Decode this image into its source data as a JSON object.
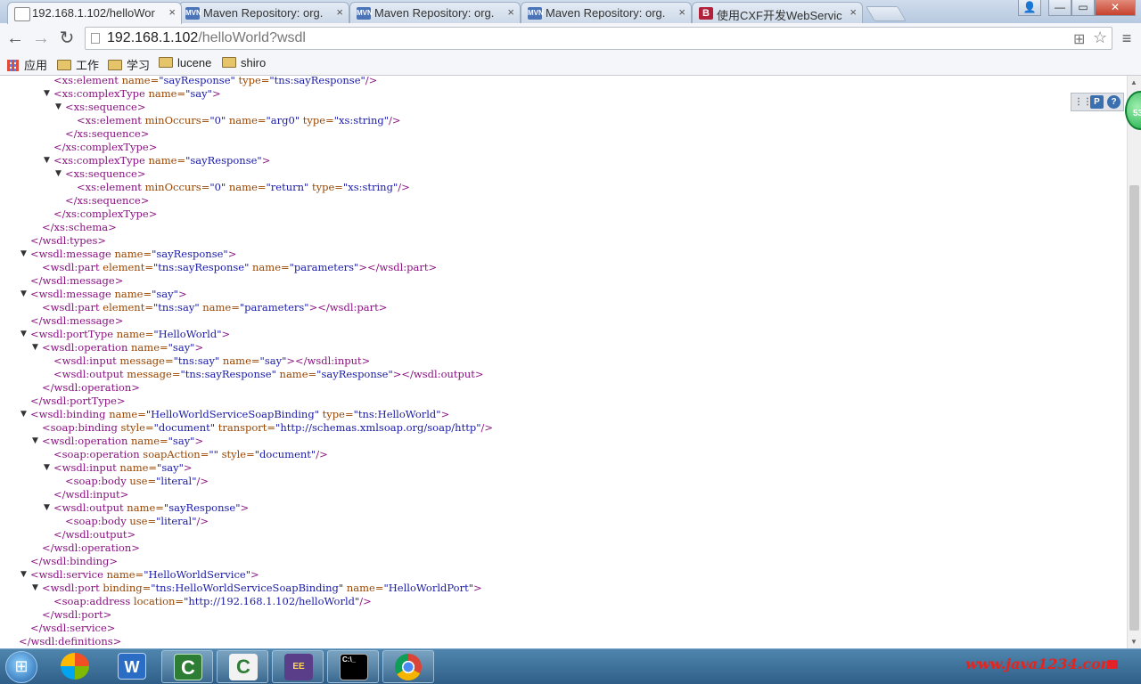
{
  "tabs": [
    {
      "title": "192.168.1.102/helloWor",
      "active": true,
      "favicon": "page-icon"
    },
    {
      "title": "Maven Repository: org.",
      "favicon": "maven-icon"
    },
    {
      "title": "Maven Repository: org.",
      "favicon": "maven-icon"
    },
    {
      "title": "Maven Repository: org.",
      "favicon": "maven-icon"
    },
    {
      "title": "使用CXF开发WebService",
      "favicon": "baidu-icon"
    }
  ],
  "favicon_maven_text": "MVN",
  "favicon_baidu_text": "B",
  "tab_close": "×",
  "window_buttons": {
    "minimize": "—",
    "maximize": "▭",
    "close": "✕"
  },
  "nav": {
    "back": "←",
    "forward": "→",
    "reload": "↻",
    "menu": "≡"
  },
  "omnibox": {
    "host": "192.168.1.102",
    "path": "/helloWorld?wsdl",
    "translate_icon": "⊞",
    "star_icon": "☆"
  },
  "bookmarks": [
    {
      "label": "应用",
      "kind": "apps"
    },
    {
      "label": "工作",
      "kind": "folder"
    },
    {
      "label": "学习",
      "kind": "folder"
    },
    {
      "label": "lucene",
      "kind": "folder"
    },
    {
      "label": "shiro",
      "kind": "folder"
    }
  ],
  "xml_lines": [
    {
      "indent": 3,
      "collapsible": false,
      "parts": [
        [
          "tg",
          "<xs:element"
        ],
        [
          "an",
          " name="
        ],
        [
          "av",
          "\"sayResponse\""
        ],
        [
          "an",
          " type="
        ],
        [
          "av",
          "\"tns:sayResponse\""
        ],
        [
          "tg",
          "/>"
        ]
      ]
    },
    {
      "indent": 3,
      "collapsible": true,
      "parts": [
        [
          "tg",
          "<xs:complexType"
        ],
        [
          "an",
          " name="
        ],
        [
          "av",
          "\"say\""
        ],
        [
          "tg",
          ">"
        ]
      ]
    },
    {
      "indent": 4,
      "collapsible": true,
      "parts": [
        [
          "tg",
          "<xs:sequence>"
        ]
      ]
    },
    {
      "indent": 5,
      "collapsible": false,
      "parts": [
        [
          "tg",
          "<xs:element"
        ],
        [
          "an",
          " minOccurs="
        ],
        [
          "av",
          "\"0\""
        ],
        [
          "an",
          " name="
        ],
        [
          "av",
          "\"arg0\""
        ],
        [
          "an",
          " type="
        ],
        [
          "av",
          "\"xs:string\""
        ],
        [
          "tg",
          "/>"
        ]
      ]
    },
    {
      "indent": 4,
      "collapsible": false,
      "parts": [
        [
          "tg",
          "</xs:sequence>"
        ]
      ]
    },
    {
      "indent": 3,
      "collapsible": false,
      "parts": [
        [
          "tg",
          "</xs:complexType>"
        ]
      ]
    },
    {
      "indent": 3,
      "collapsible": true,
      "parts": [
        [
          "tg",
          "<xs:complexType"
        ],
        [
          "an",
          " name="
        ],
        [
          "av",
          "\"sayResponse\""
        ],
        [
          "tg",
          ">"
        ]
      ]
    },
    {
      "indent": 4,
      "collapsible": true,
      "parts": [
        [
          "tg",
          "<xs:sequence>"
        ]
      ]
    },
    {
      "indent": 5,
      "collapsible": false,
      "parts": [
        [
          "tg",
          "<xs:element"
        ],
        [
          "an",
          " minOccurs="
        ],
        [
          "av",
          "\"0\""
        ],
        [
          "an",
          " name="
        ],
        [
          "av",
          "\"return\""
        ],
        [
          "an",
          " type="
        ],
        [
          "av",
          "\"xs:string\""
        ],
        [
          "tg",
          "/>"
        ]
      ]
    },
    {
      "indent": 4,
      "collapsible": false,
      "parts": [
        [
          "tg",
          "</xs:sequence>"
        ]
      ]
    },
    {
      "indent": 3,
      "collapsible": false,
      "parts": [
        [
          "tg",
          "</xs:complexType>"
        ]
      ]
    },
    {
      "indent": 2,
      "collapsible": false,
      "parts": [
        [
          "tg",
          "</xs:schema>"
        ]
      ]
    },
    {
      "indent": 1,
      "collapsible": false,
      "parts": [
        [
          "tg",
          "</wsdl:types>"
        ]
      ]
    },
    {
      "indent": 1,
      "collapsible": true,
      "parts": [
        [
          "tg",
          "<wsdl:message"
        ],
        [
          "an",
          " name="
        ],
        [
          "av",
          "\"sayResponse\""
        ],
        [
          "tg",
          ">"
        ]
      ]
    },
    {
      "indent": 2,
      "collapsible": false,
      "parts": [
        [
          "tg",
          "<wsdl:part"
        ],
        [
          "an",
          " element="
        ],
        [
          "av",
          "\"tns:sayResponse\""
        ],
        [
          "an",
          " name="
        ],
        [
          "av",
          "\"parameters\""
        ],
        [
          "tg",
          "></wsdl:part>"
        ]
      ]
    },
    {
      "indent": 1,
      "collapsible": false,
      "parts": [
        [
          "tg",
          "</wsdl:message>"
        ]
      ]
    },
    {
      "indent": 1,
      "collapsible": true,
      "parts": [
        [
          "tg",
          "<wsdl:message"
        ],
        [
          "an",
          " name="
        ],
        [
          "av",
          "\"say\""
        ],
        [
          "tg",
          ">"
        ]
      ]
    },
    {
      "indent": 2,
      "collapsible": false,
      "parts": [
        [
          "tg",
          "<wsdl:part"
        ],
        [
          "an",
          " element="
        ],
        [
          "av",
          "\"tns:say\""
        ],
        [
          "an",
          " name="
        ],
        [
          "av",
          "\"parameters\""
        ],
        [
          "tg",
          "></wsdl:part>"
        ]
      ]
    },
    {
      "indent": 1,
      "collapsible": false,
      "parts": [
        [
          "tg",
          "</wsdl:message>"
        ]
      ]
    },
    {
      "indent": 1,
      "collapsible": true,
      "parts": [
        [
          "tg",
          "<wsdl:portType"
        ],
        [
          "an",
          " name="
        ],
        [
          "av",
          "\"HelloWorld\""
        ],
        [
          "tg",
          ">"
        ]
      ]
    },
    {
      "indent": 2,
      "collapsible": true,
      "parts": [
        [
          "tg",
          "<wsdl:operation"
        ],
        [
          "an",
          " name="
        ],
        [
          "av",
          "\"say\""
        ],
        [
          "tg",
          ">"
        ]
      ]
    },
    {
      "indent": 3,
      "collapsible": false,
      "parts": [
        [
          "tg",
          "<wsdl:input"
        ],
        [
          "an",
          " message="
        ],
        [
          "av",
          "\"tns:say\""
        ],
        [
          "an",
          " name="
        ],
        [
          "av",
          "\"say\""
        ],
        [
          "tg",
          "></wsdl:input>"
        ]
      ]
    },
    {
      "indent": 3,
      "collapsible": false,
      "parts": [
        [
          "tg",
          "<wsdl:output"
        ],
        [
          "an",
          " message="
        ],
        [
          "av",
          "\"tns:sayResponse\""
        ],
        [
          "an",
          " name="
        ],
        [
          "av",
          "\"sayResponse\""
        ],
        [
          "tg",
          "></wsdl:output>"
        ]
      ]
    },
    {
      "indent": 2,
      "collapsible": false,
      "parts": [
        [
          "tg",
          "</wsdl:operation>"
        ]
      ]
    },
    {
      "indent": 1,
      "collapsible": false,
      "parts": [
        [
          "tg",
          "</wsdl:portType>"
        ]
      ]
    },
    {
      "indent": 1,
      "collapsible": true,
      "parts": [
        [
          "tg",
          "<wsdl:binding"
        ],
        [
          "an",
          " name="
        ],
        [
          "av",
          "\"HelloWorldServiceSoapBinding\""
        ],
        [
          "an",
          " type="
        ],
        [
          "av",
          "\"tns:HelloWorld\""
        ],
        [
          "tg",
          ">"
        ]
      ]
    },
    {
      "indent": 2,
      "collapsible": false,
      "parts": [
        [
          "tg",
          "<soap:binding"
        ],
        [
          "an",
          " style="
        ],
        [
          "av",
          "\"document\""
        ],
        [
          "an",
          " transport="
        ],
        [
          "av",
          "\"http://schemas.xmlsoap.org/soap/http\""
        ],
        [
          "tg",
          "/>"
        ]
      ]
    },
    {
      "indent": 2,
      "collapsible": true,
      "parts": [
        [
          "tg",
          "<wsdl:operation"
        ],
        [
          "an",
          " name="
        ],
        [
          "av",
          "\"say\""
        ],
        [
          "tg",
          ">"
        ]
      ]
    },
    {
      "indent": 3,
      "collapsible": false,
      "parts": [
        [
          "tg",
          "<soap:operation"
        ],
        [
          "an",
          " soapAction="
        ],
        [
          "av",
          "\"\""
        ],
        [
          "an",
          " style="
        ],
        [
          "av",
          "\"document\""
        ],
        [
          "tg",
          "/>"
        ]
      ]
    },
    {
      "indent": 3,
      "collapsible": true,
      "parts": [
        [
          "tg",
          "<wsdl:input"
        ],
        [
          "an",
          " name="
        ],
        [
          "av",
          "\"say\""
        ],
        [
          "tg",
          ">"
        ]
      ]
    },
    {
      "indent": 4,
      "collapsible": false,
      "parts": [
        [
          "tg",
          "<soap:body"
        ],
        [
          "an",
          " use="
        ],
        [
          "av",
          "\"literal\""
        ],
        [
          "tg",
          "/>"
        ]
      ]
    },
    {
      "indent": 3,
      "collapsible": false,
      "parts": [
        [
          "tg",
          "</wsdl:input>"
        ]
      ]
    },
    {
      "indent": 3,
      "collapsible": true,
      "parts": [
        [
          "tg",
          "<wsdl:output"
        ],
        [
          "an",
          " name="
        ],
        [
          "av",
          "\"sayResponse\""
        ],
        [
          "tg",
          ">"
        ]
      ]
    },
    {
      "indent": 4,
      "collapsible": false,
      "parts": [
        [
          "tg",
          "<soap:body"
        ],
        [
          "an",
          " use="
        ],
        [
          "av",
          "\"literal\""
        ],
        [
          "tg",
          "/>"
        ]
      ]
    },
    {
      "indent": 3,
      "collapsible": false,
      "parts": [
        [
          "tg",
          "</wsdl:output>"
        ]
      ]
    },
    {
      "indent": 2,
      "collapsible": false,
      "parts": [
        [
          "tg",
          "</wsdl:operation>"
        ]
      ]
    },
    {
      "indent": 1,
      "collapsible": false,
      "parts": [
        [
          "tg",
          "</wsdl:binding>"
        ]
      ]
    },
    {
      "indent": 1,
      "collapsible": true,
      "parts": [
        [
          "tg",
          "<wsdl:service"
        ],
        [
          "an",
          " name="
        ],
        [
          "av",
          "\"HelloWorldService\""
        ],
        [
          "tg",
          ">"
        ]
      ]
    },
    {
      "indent": 2,
      "collapsible": true,
      "parts": [
        [
          "tg",
          "<wsdl:port"
        ],
        [
          "an",
          " binding="
        ],
        [
          "av",
          "\"tns:HelloWorldServiceSoapBinding\""
        ],
        [
          "an",
          " name="
        ],
        [
          "av",
          "\"HelloWorldPort\""
        ],
        [
          "tg",
          ">"
        ]
      ]
    },
    {
      "indent": 3,
      "collapsible": false,
      "parts": [
        [
          "tg",
          "<soap:address"
        ],
        [
          "an",
          " location="
        ],
        [
          "av",
          "\"http://192.168.1.102/helloWorld\""
        ],
        [
          "tg",
          "/>"
        ]
      ]
    },
    {
      "indent": 2,
      "collapsible": false,
      "parts": [
        [
          "tg",
          "</wsdl:port>"
        ]
      ]
    },
    {
      "indent": 1,
      "collapsible": false,
      "parts": [
        [
          "tg",
          "</wsdl:service>"
        ]
      ]
    },
    {
      "indent": 0,
      "collapsible": false,
      "parts": [
        [
          "tg",
          "</wsdl:definitions>"
        ]
      ]
    }
  ],
  "collapse_glyph": "▼",
  "extension_widget": {
    "p_label": "P",
    "help_label": "?"
  },
  "floating_badge": "53",
  "taskbar": {
    "items": [
      {
        "name": "start",
        "glyph": "⊞"
      },
      {
        "name": "app-launcher",
        "glyph": ""
      },
      {
        "name": "word-app",
        "glyph": "W"
      },
      {
        "name": "camtasia-app-1",
        "glyph": "C"
      },
      {
        "name": "camtasia-app-2",
        "glyph": "C"
      },
      {
        "name": "javaee-app",
        "glyph": "EE"
      },
      {
        "name": "cmd-app",
        "glyph": "C:\\_"
      },
      {
        "name": "chrome-app",
        "glyph": ""
      }
    ]
  },
  "watermark": "www.java1234.com",
  "colors": {
    "tag": "#881280",
    "attr_name": "#994500",
    "attr_value": "#1a1aa6",
    "watermark": "#e8231c"
  }
}
